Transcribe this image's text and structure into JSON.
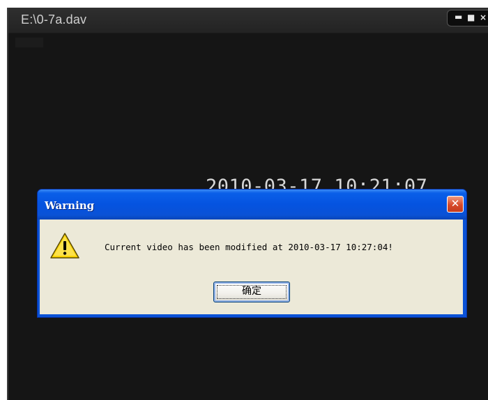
{
  "player": {
    "title": "E:\\0-7a.dav",
    "timestamp": "2010-03-17 10:21:07",
    "controls": {
      "minimize_icon": "minimize-icon",
      "maximize_icon": "maximize-icon",
      "close_icon": "close-icon"
    }
  },
  "dialog": {
    "title": "Warning",
    "message": "Current video has been modified at 2010-03-17 10:27:04!",
    "ok_label": "确定",
    "icon": "warning-icon",
    "close_glyph": "✕"
  },
  "colors": {
    "dialog_titlebar": "#0a52d6",
    "dialog_body": "#ece9d8",
    "close_button": "#d7492a",
    "video_background": "#151515"
  }
}
